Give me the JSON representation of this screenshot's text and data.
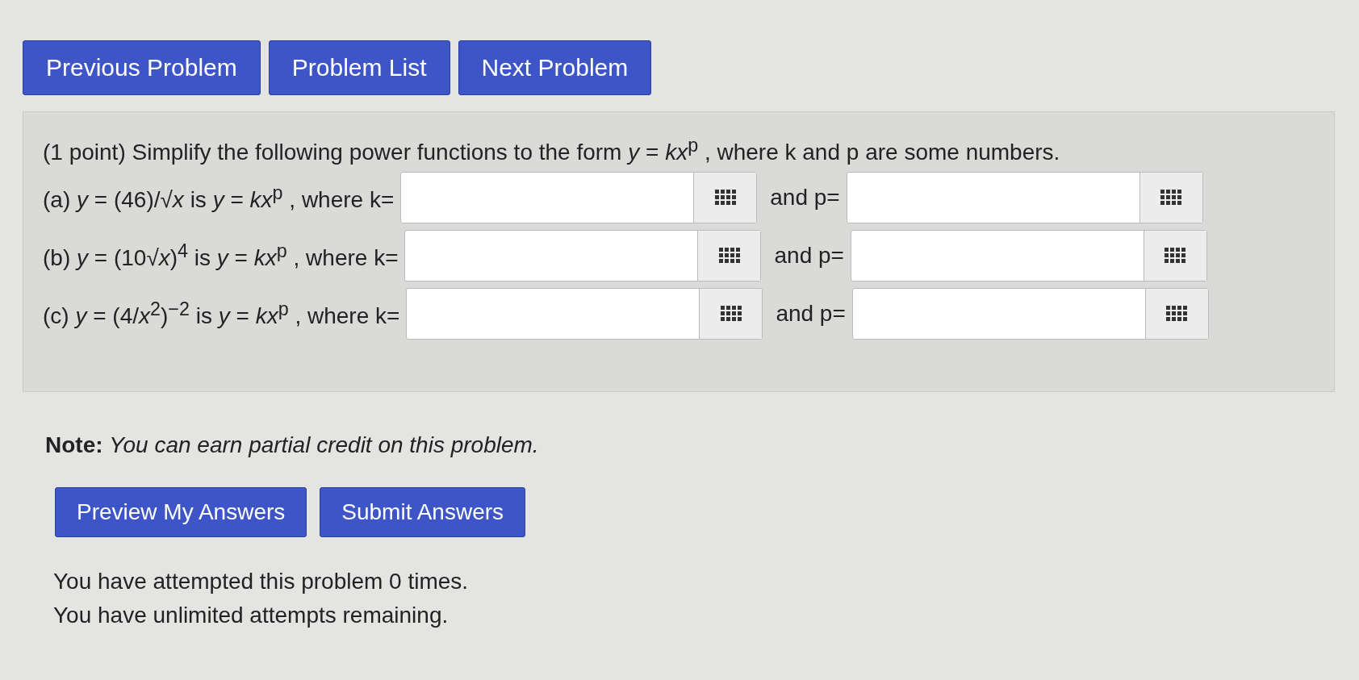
{
  "nav_buttons": [
    "Previous Problem",
    "Problem List",
    "Next Problem"
  ],
  "problem": {
    "intro": "(1 point) Simplify the following power functions to the form *y* = *kx*$^{p}$ , where k and p are some numbers.",
    "parts": [
      {
        "prompt": "(a) *y* = (46)/√*x* is *y* = *kx*$^{p}$ , where k=",
        "second_label": "and p="
      },
      {
        "prompt": "(b) *y* = (10√*x*)$^{4}$ is *y* = *kx*$^{p}$ , where k=",
        "second_label": "and p="
      },
      {
        "prompt": "(c) *y* = (4/*x*$^{2}$)$^{−2}$ is *y* = *kx*$^{p}$ , where k=",
        "second_label": "and p="
      }
    ]
  },
  "note": "**Note:** *You can earn partial credit on this problem.*",
  "action_buttons": [
    "Preview My Answers",
    "Submit Answers"
  ],
  "status_lines": [
    "You have attempted this problem 0 times.",
    "You have unlimited attempts remaining."
  ]
}
